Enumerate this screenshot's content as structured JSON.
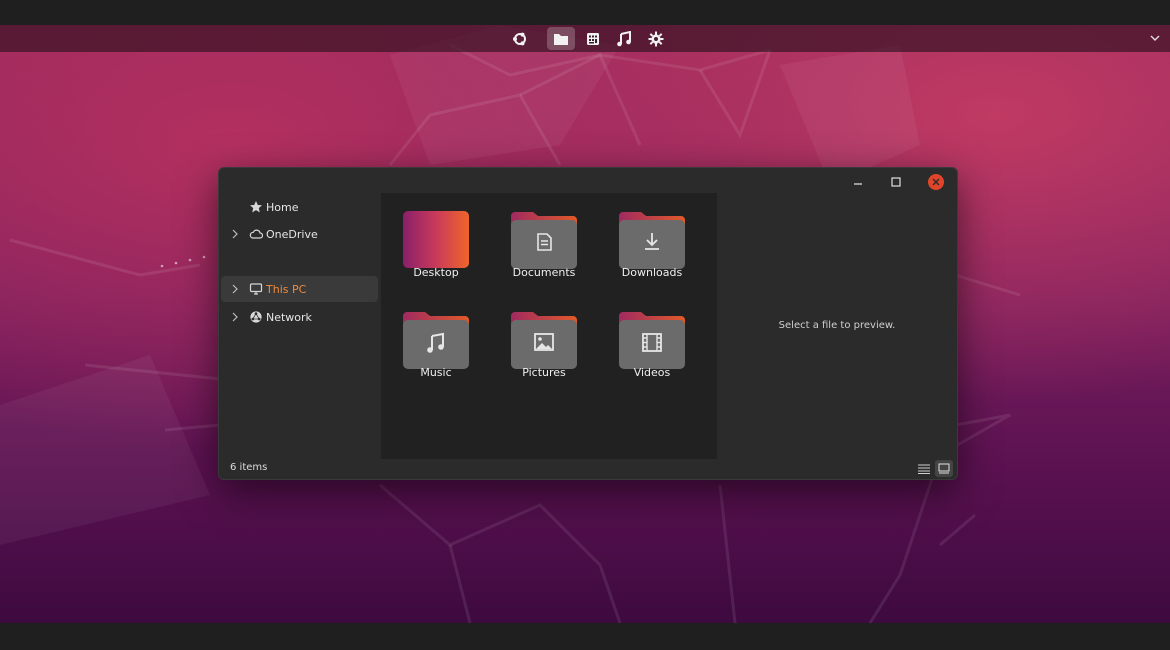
{
  "dock": {
    "items": [
      {
        "id": "ubuntu",
        "icon": "ubuntu-logo-icon",
        "active": false
      },
      {
        "id": "files",
        "icon": "folder-icon",
        "active": true
      },
      {
        "id": "calculator",
        "icon": "calculator-icon",
        "active": false
      },
      {
        "id": "music",
        "icon": "music-note-icon",
        "active": false
      },
      {
        "id": "settings",
        "icon": "gear-icon",
        "active": false
      }
    ]
  },
  "sidebar": {
    "items": [
      {
        "label": "Home",
        "icon": "star-icon",
        "expandable": false,
        "selected": false
      },
      {
        "label": "OneDrive",
        "icon": "cloud-icon",
        "expandable": true,
        "selected": false
      },
      {
        "label": "This PC",
        "icon": "monitor-icon",
        "expandable": true,
        "selected": true
      },
      {
        "label": "Network",
        "icon": "network-icon",
        "expandable": true,
        "selected": false
      }
    ]
  },
  "folders": [
    {
      "label": "Desktop",
      "icon": "desktop-folder-icon"
    },
    {
      "label": "Documents",
      "icon": "document-icon"
    },
    {
      "label": "Downloads",
      "icon": "download-icon"
    },
    {
      "label": "Music",
      "icon": "music-note-icon"
    },
    {
      "label": "Pictures",
      "icon": "image-icon"
    },
    {
      "label": "Videos",
      "icon": "film-icon"
    }
  ],
  "preview": {
    "message": "Select a file to preview."
  },
  "status": {
    "count": "6 items"
  },
  "colors": {
    "accent": "#f08a3c",
    "close": "#e0452a",
    "folder_tab_top": "#e05a2a",
    "folder_tab_bottom": "#a02a60",
    "folder_body": "#6b6b6b"
  }
}
